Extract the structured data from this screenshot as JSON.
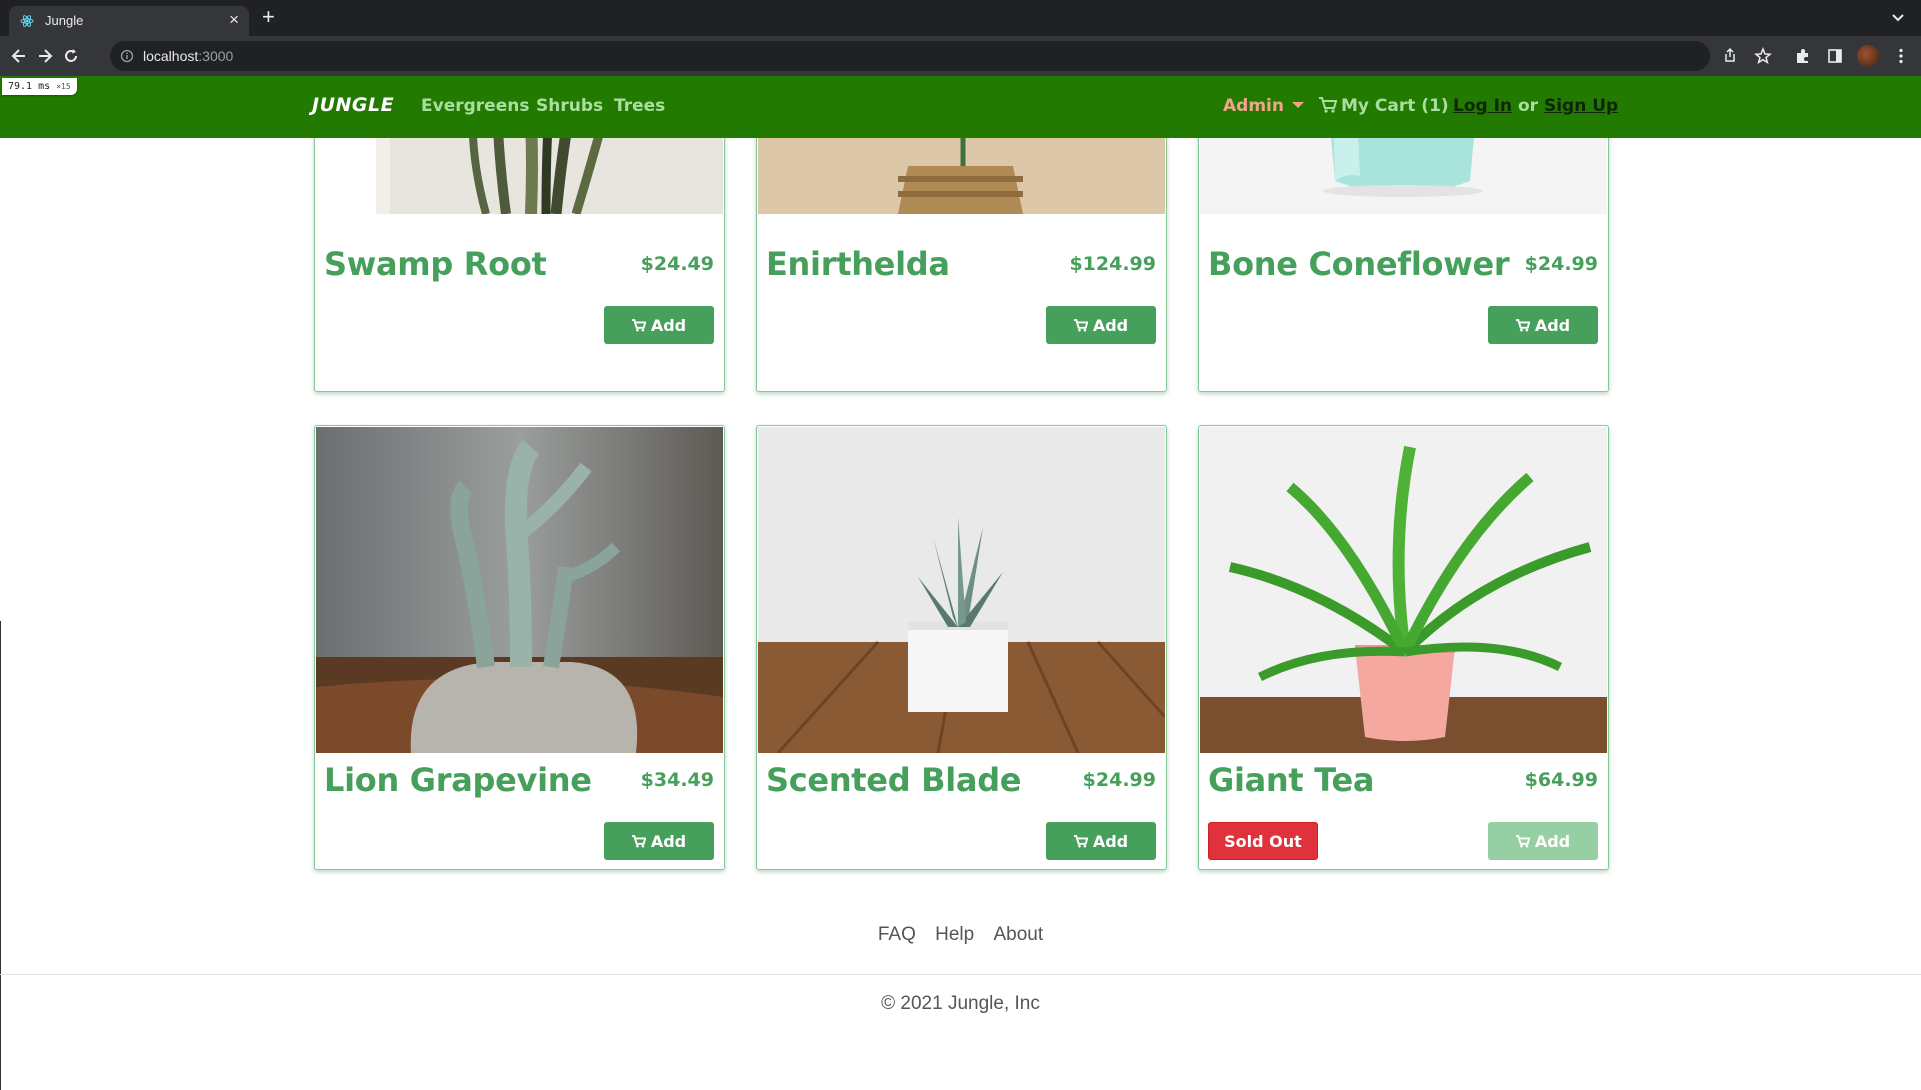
{
  "browser": {
    "tab_title": "Jungle",
    "url_host": "localhost",
    "url_port": ":3000"
  },
  "perf": {
    "value": "79.1",
    "unit": "ms",
    "sub": "×15"
  },
  "nav": {
    "brand": "JUNGLE",
    "categories": [
      "Evergreens",
      "Shrubs",
      "Trees"
    ],
    "admin_label": "Admin",
    "cart_label": "My Cart (1)",
    "login_label": "Log In",
    "or_label": "or",
    "signup_label": "Sign Up",
    "colors": {
      "bar": "#237a00",
      "link": "#a8dfa0",
      "admin": "#f0a58a"
    }
  },
  "products": [
    {
      "name": "Swamp Root",
      "price": "$24.49",
      "button": "Add",
      "sold_out": false,
      "image": "snake-plant"
    },
    {
      "name": "Enirthelda",
      "price": "$124.99",
      "button": "Add",
      "sold_out": false,
      "image": "jade-plant"
    },
    {
      "name": "Bone Coneflower",
      "price": "$24.99",
      "button": "Add",
      "sold_out": false,
      "image": "mint-vase"
    },
    {
      "name": "Lion Grapevine",
      "price": "$34.49",
      "button": "Add",
      "sold_out": false,
      "image": "cactus"
    },
    {
      "name": "Scented Blade",
      "price": "$24.99",
      "button": "Add",
      "sold_out": false,
      "image": "succulent"
    },
    {
      "name": "Giant Tea",
      "price": "$64.99",
      "button": "Add",
      "sold_out": true,
      "sold_out_label": "Sold Out",
      "image": "birds-nest-fern"
    }
  ],
  "footer": {
    "links": [
      "FAQ",
      "Help",
      "About"
    ],
    "copyright": "© 2021 Jungle, Inc"
  },
  "colors": {
    "accent": "#46a05c",
    "sold_out": "#e0323c"
  }
}
